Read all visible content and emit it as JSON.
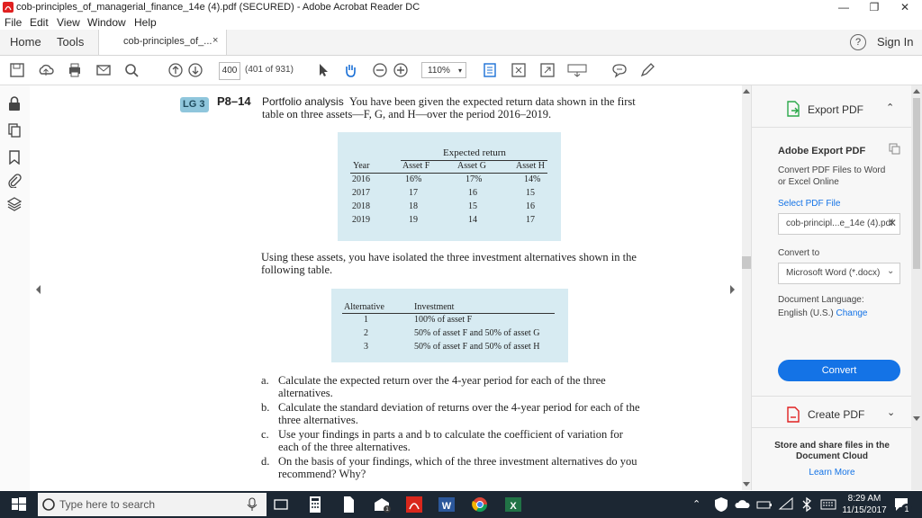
{
  "window": {
    "title": "cob-principles_of_managerial_finance_14e (4).pdf (SECURED) - Adobe Acrobat Reader DC",
    "minimize": "—",
    "maximize": "❐",
    "close": "✕"
  },
  "menu": [
    "File",
    "Edit",
    "View",
    "Window",
    "Help"
  ],
  "tabs": {
    "home": "Home",
    "tools": "Tools",
    "doc_tab": "cob-principles_of_...",
    "doc_close": "×",
    "help": "?",
    "sign_in": "Sign In"
  },
  "toolbar": {
    "page_current": "400",
    "page_total": "(401 of 931)",
    "zoom": "110%"
  },
  "doc": {
    "lg_badge": "LG 3",
    "problem_no": "P8–14",
    "problem_title": "Portfolio analysis",
    "intro_line1": "You have been given the expected return data shown in the first",
    "intro_line2": "table on three assets—F, G, and H—over the period 2016–2019.",
    "table1": {
      "title": "Expected return",
      "headers": [
        "Year",
        "Asset F",
        "Asset G",
        "Asset H"
      ],
      "rows": [
        [
          "2016",
          "16%",
          "17%",
          "14%"
        ],
        [
          "2017",
          "17",
          "16",
          "15"
        ],
        [
          "2018",
          "18",
          "15",
          "16"
        ],
        [
          "2019",
          "19",
          "14",
          "17"
        ]
      ]
    },
    "mid_line1": "Using these assets, you have isolated the three investment alternatives shown in the",
    "mid_line2": "following table.",
    "table2": {
      "headers": [
        "Alternative",
        "Investment"
      ],
      "rows": [
        [
          "1",
          "100% of asset F"
        ],
        [
          "2",
          "50% of asset F and 50% of asset G"
        ],
        [
          "3",
          "50% of asset F and 50% of asset H"
        ]
      ]
    },
    "questions": [
      {
        "letter": "a.",
        "line1": "Calculate the expected return over the 4-year period for each of the three",
        "line2": "alternatives."
      },
      {
        "letter": "b.",
        "line1": "Calculate the standard deviation of returns over the 4-year period for each of the",
        "line2": "three alternatives."
      },
      {
        "letter": "c.",
        "line1": "Use your findings in parts a and b to calculate the coefficient of variation for",
        "line2": "each of the three alternatives."
      },
      {
        "letter": "d.",
        "line1": "On the basis of your findings, which of the three investment alternatives do you",
        "line2": "recommend? Why?"
      }
    ]
  },
  "right_panel": {
    "export_pdf": "Export PDF",
    "adobe_export": "Adobe Export PDF",
    "convert_desc1": "Convert PDF Files to Word",
    "convert_desc2": "or Excel Online",
    "select_pdf": "Select PDF File",
    "selected_file": "cob-principl...e_14e (4).pdf",
    "convert_to": "Convert to",
    "format": "Microsoft Word (*.docx)",
    "doc_language_label": "Document Language:",
    "doc_language": "English (U.S.)",
    "change": "Change",
    "convert_button": "Convert",
    "create_pdf": "Create PDF",
    "store_line1": "Store and share files in the",
    "store_line2": "Document Cloud",
    "learn_more": "Learn More",
    "accent": "#1473e6"
  },
  "taskbar": {
    "search_placeholder": "Type here to search",
    "time": "8:29 AM",
    "date": "11/15/2017",
    "notification_count": "1"
  }
}
